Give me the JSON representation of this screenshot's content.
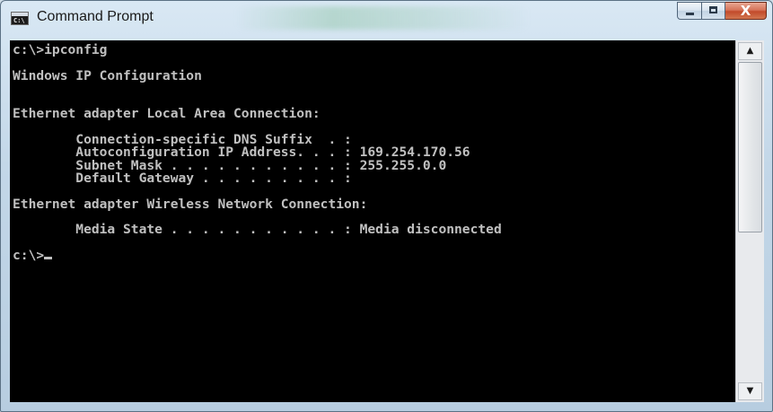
{
  "window": {
    "title": "Command Prompt",
    "icon": "console-icon",
    "icon_glyph": "C:\\",
    "buttons": {
      "minimize": "minimize-icon",
      "maximize": "maximize-icon",
      "close": "X"
    }
  },
  "console": {
    "lines": [
      "c:\\>ipconfig",
      "",
      "Windows IP Configuration",
      "",
      "",
      "Ethernet adapter Local Area Connection:",
      "",
      "        Connection-specific DNS Suffix  . :",
      "        Autoconfiguration IP Address. . . : 169.254.170.56",
      "        Subnet Mask . . . . . . . . . . . : 255.255.0.0",
      "        Default Gateway . . . . . . . . . :",
      "",
      "Ethernet adapter Wireless Network Connection:",
      "",
      "        Media State . . . . . . . . . . . : Media disconnected",
      "",
      "c:\\>"
    ],
    "text_color": "#c0c0c0",
    "background": "#000000"
  },
  "scrollbar": {
    "up_arrow": "▲",
    "down_arrow": "▼"
  }
}
